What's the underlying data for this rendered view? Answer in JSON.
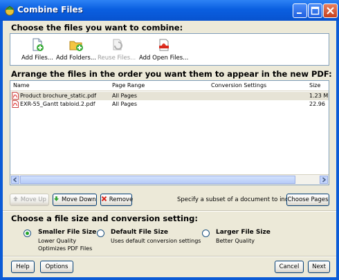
{
  "window": {
    "title": "Combine Files"
  },
  "sections": {
    "choose_files": "Choose the files you want to combine:",
    "arrange": "Arrange the files in the order you want them to appear in the new PDF:",
    "conversion": "Choose a file size and conversion setting:"
  },
  "toolbar": {
    "add_files": "Add Files...",
    "add_folders": "Add Folders...",
    "reuse_files": "Reuse Files...",
    "add_open_files": "Add Open Files..."
  },
  "file_list": {
    "columns": [
      "Name",
      "Page Range",
      "Conversion Settings",
      "Size"
    ],
    "rows": [
      {
        "name": "Product brochure_static.pdf",
        "page_range": "All Pages",
        "conversion": "",
        "size": "1.23 M"
      },
      {
        "name": "EXR-55_Gantt tabloid.2.pdf",
        "page_range": "All Pages",
        "conversion": "",
        "size": "22.96"
      }
    ]
  },
  "list_buttons": {
    "move_up": "Move Up",
    "move_down": "Move Down",
    "remove": "Remove",
    "subset_text": "Specify a subset of a document to include:",
    "choose_pages": "Choose Pages"
  },
  "options": [
    {
      "label": "Smaller File Size",
      "lines": [
        "Lower Quality",
        "Optimizes PDF Files"
      ],
      "selected": true
    },
    {
      "label": "Default File Size",
      "lines": [
        "Uses default conversion settings"
      ],
      "selected": false
    },
    {
      "label": "Larger File Size",
      "lines": [
        "Better Quality"
      ],
      "selected": false
    }
  ],
  "footer": {
    "help": "Help",
    "options": "Options",
    "cancel": "Cancel",
    "next": "Next"
  }
}
